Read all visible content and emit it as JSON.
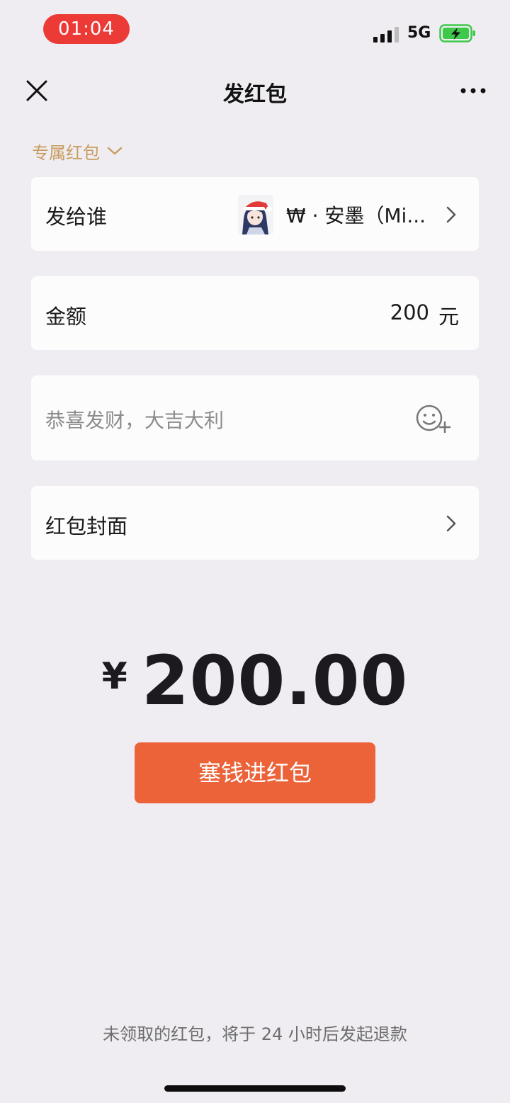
{
  "status_bar": {
    "time": "01:04",
    "network": "5G"
  },
  "nav": {
    "title": "发红包"
  },
  "packet_type": {
    "label": "专属红包"
  },
  "recipient": {
    "label": "发给谁",
    "name": "₩ · 安墨（Mi..."
  },
  "amount": {
    "label": "金额",
    "value": "200",
    "unit": "元"
  },
  "greeting": {
    "placeholder": "恭喜发财，大吉大利"
  },
  "cover": {
    "label": "红包封面"
  },
  "total": {
    "currency": "¥",
    "value": "200.00"
  },
  "submit": {
    "label": "塞钱进红包"
  },
  "footer": {
    "note": "未领取的红包，将于 24 小时后发起退款"
  },
  "colors": {
    "accent": "#ec6239",
    "gold": "#c89c5e",
    "background": "#efedf2",
    "time_pill": "#ec3a36",
    "battery": "#3ec94a"
  }
}
